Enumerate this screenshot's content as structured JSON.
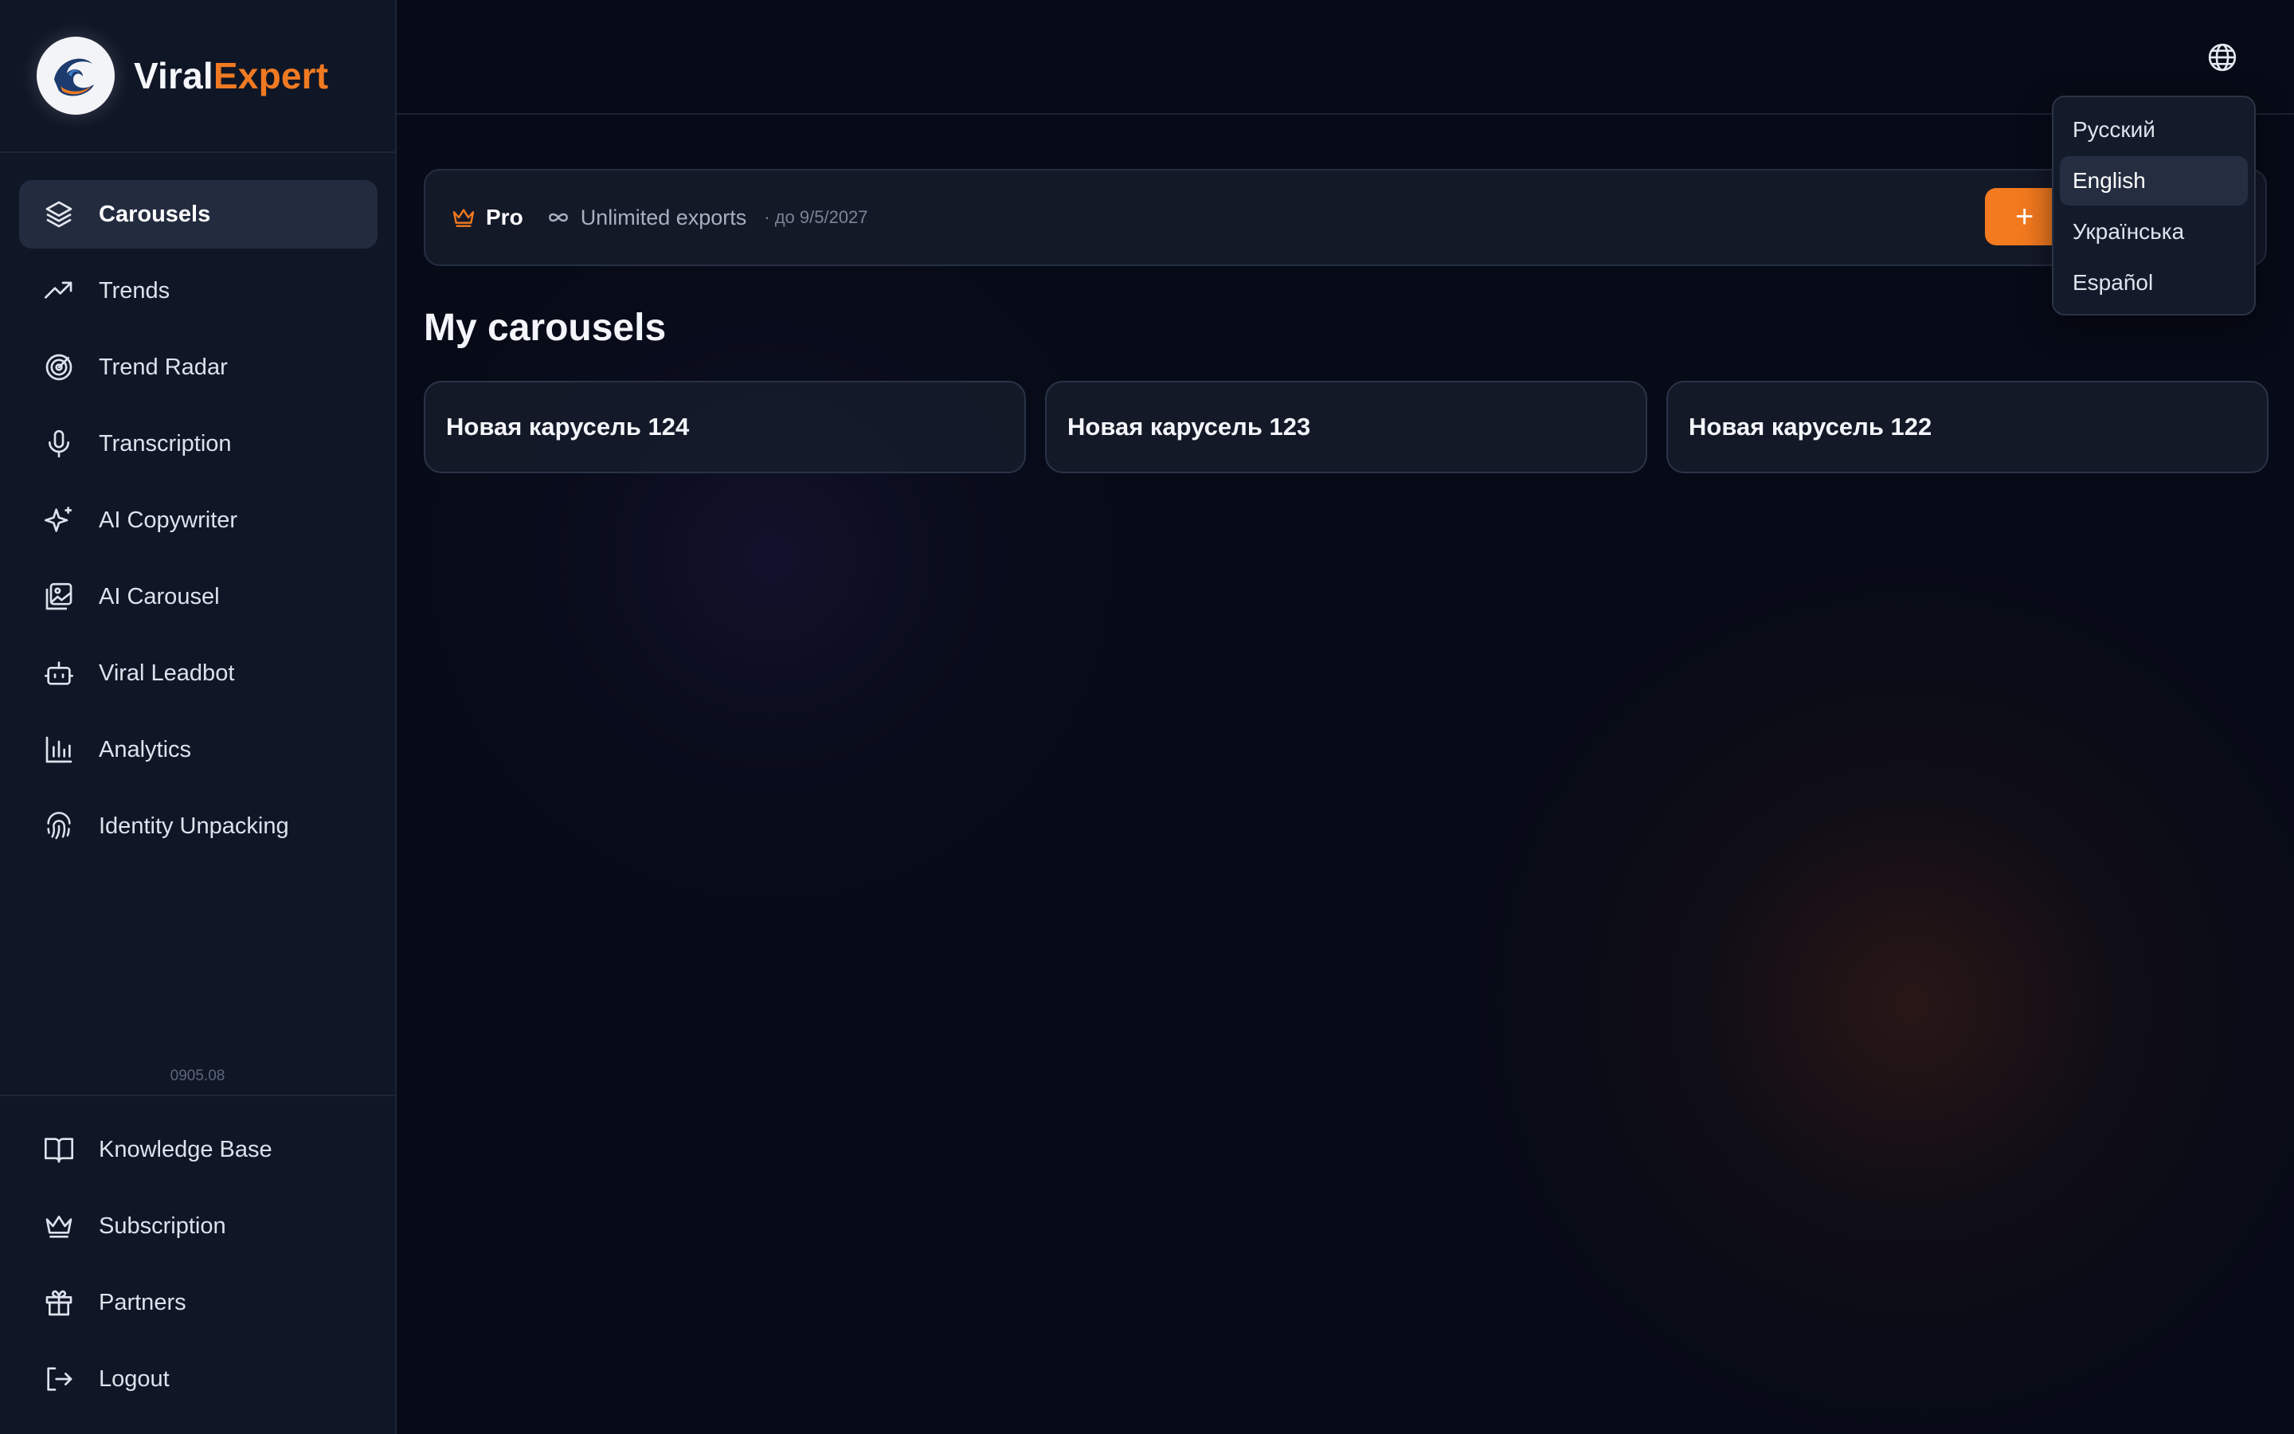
{
  "brand": {
    "name_part1": "Viral",
    "name_part2": "Expert"
  },
  "sidebar": {
    "items": [
      {
        "label": "Carousels",
        "icon": "layers-icon",
        "active": true
      },
      {
        "label": "Trends",
        "icon": "trending-up-icon"
      },
      {
        "label": "Trend Radar",
        "icon": "radar-icon"
      },
      {
        "label": "Transcription",
        "icon": "microphone-icon"
      },
      {
        "label": "AI Copywriter",
        "icon": "sparkles-icon"
      },
      {
        "label": "AI Carousel",
        "icon": "images-icon"
      },
      {
        "label": "Viral Leadbot",
        "icon": "bot-icon"
      },
      {
        "label": "Analytics",
        "icon": "bar-chart-icon"
      },
      {
        "label": "Identity Unpacking",
        "icon": "fingerprint-icon"
      }
    ],
    "version": "0905.08",
    "bottom_items": [
      {
        "label": "Knowledge Base",
        "icon": "book-icon"
      },
      {
        "label": "Subscription",
        "icon": "crown-icon"
      },
      {
        "label": "Partners",
        "icon": "gift-icon"
      },
      {
        "label": "Logout",
        "icon": "logout-icon"
      }
    ]
  },
  "plan": {
    "name": "Pro",
    "feature": "Unlimited exports",
    "until": "· до 9/5/2027",
    "create_label": "+"
  },
  "main": {
    "title": "My carousels",
    "carousels": [
      {
        "title": "Новая карусель 124"
      },
      {
        "title": "Новая карусель 123"
      },
      {
        "title": "Новая карусель 122"
      }
    ]
  },
  "language_menu": {
    "options": [
      "Русский",
      "English",
      "Українська",
      "Español"
    ],
    "selected": "English"
  },
  "colors": {
    "accent": "#f37a1f",
    "background": "#070b17",
    "sidebar": "#0f1626",
    "active_item": "#232c3f"
  }
}
